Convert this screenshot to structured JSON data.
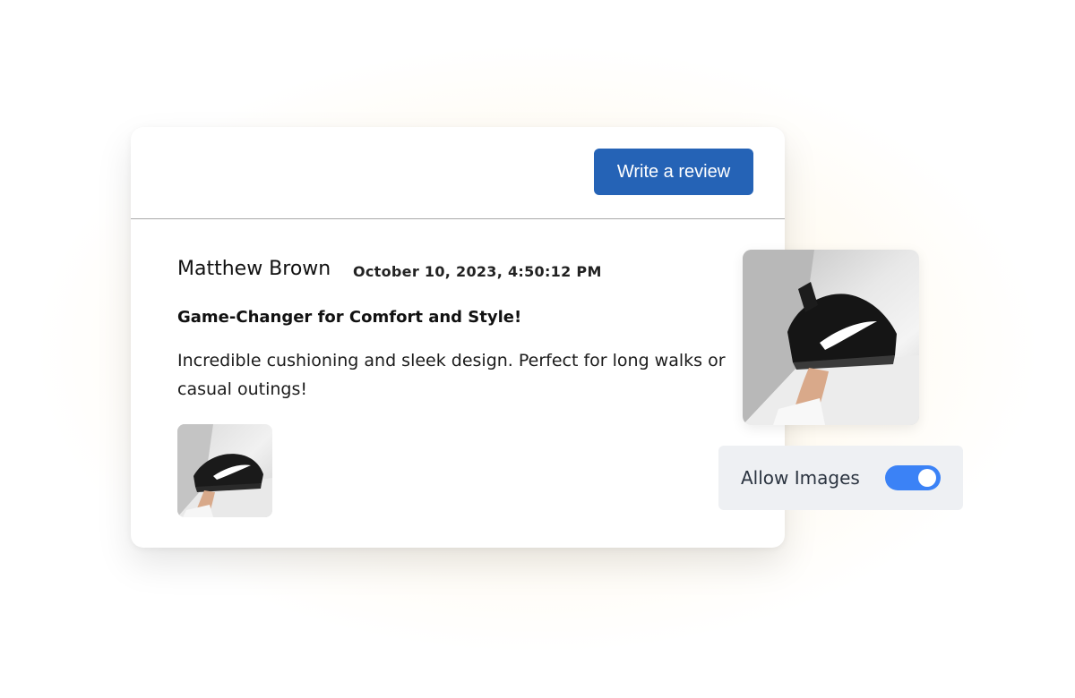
{
  "header": {
    "write_review_label": "Write a review"
  },
  "review": {
    "reviewer_name": "Matthew Brown",
    "date": "October 10, 2023, 4:50:12 PM",
    "title": "Game-Changer for Comfort and Style!",
    "body": "Incredible cushioning and sleek design. Perfect for long walks or casual outings!",
    "photo_icon": "sneaker-photo-icon"
  },
  "settings": {
    "allow_images_label": "Allow Images",
    "allow_images_enabled": true
  },
  "colors": {
    "primary_button": "#2563b6",
    "toggle_on": "#3b82f6",
    "panel_bg": "#eef0f3"
  }
}
